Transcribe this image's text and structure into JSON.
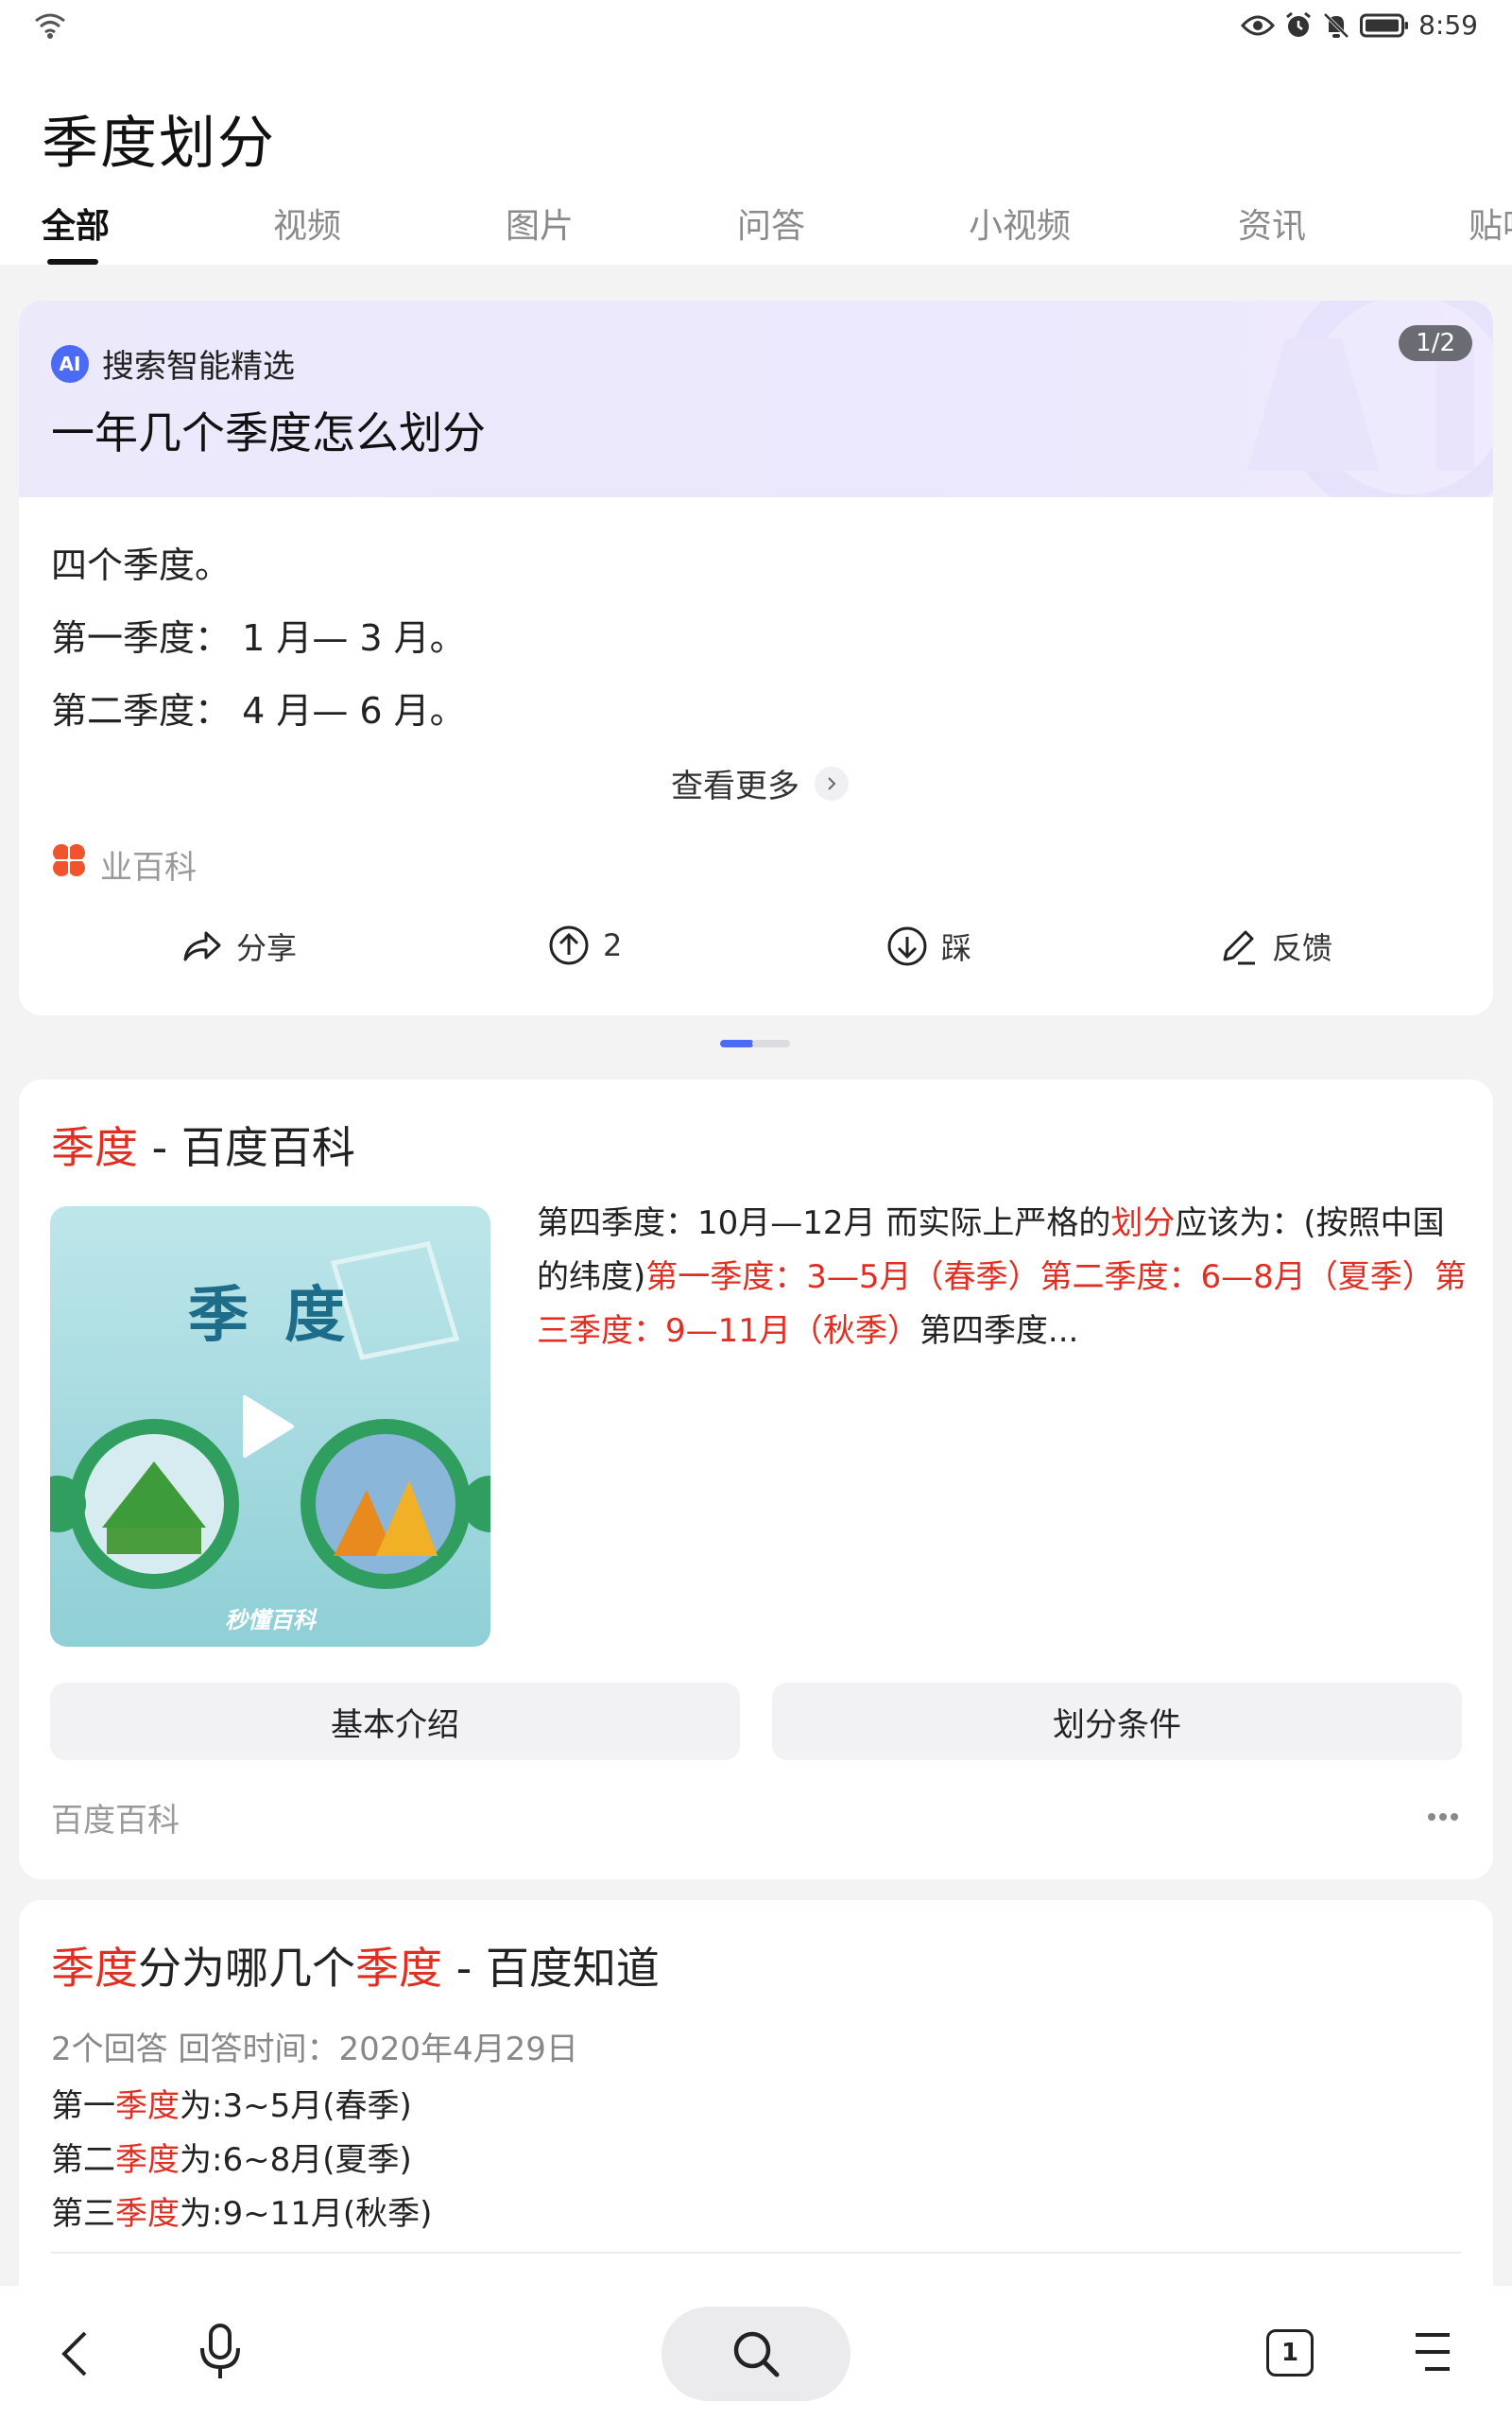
{
  "status_bar": {
    "time": "8:59",
    "icons": [
      "wifi-icon",
      "eye-icon",
      "alarm-icon",
      "bell-off-icon",
      "battery-icon"
    ]
  },
  "header": {
    "title": "季度划分",
    "tabs": [
      {
        "label": "全部",
        "active": true
      },
      {
        "label": "视频"
      },
      {
        "label": "图片"
      },
      {
        "label": "问答"
      },
      {
        "label": "小视频"
      },
      {
        "label": "资讯"
      },
      {
        "label": "贴吧"
      }
    ]
  },
  "ai_card": {
    "badge_logo": "AI",
    "badge": "搜索智能精选",
    "question": "一年几个季度怎么划分",
    "page_indicator": "1/2",
    "answer_lines": [
      "四个季度。",
      "第一季度： 1 月— 3 月。",
      "第二季度： 4 月— 6 月。"
    ],
    "view_more": "查看更多",
    "source": "业百科",
    "actions": {
      "share": "分享",
      "upvote_count": "2",
      "downvote": "踩",
      "feedback": "反馈"
    }
  },
  "baike_card": {
    "title_highlight": "季度",
    "title_rest": " - 百度百科",
    "thumb_title": "季 度",
    "thumb_brand": "秒懂百科",
    "desc_parts": [
      {
        "text": "第四季度：10月—12月 而实际上严格的",
        "hl": false
      },
      {
        "text": "划分",
        "hl": true
      },
      {
        "text": "应该为：(按照中国的纬度)",
        "hl": false
      },
      {
        "text": "第一季度：3—5月（春季）第二季度：6—8月（夏季）第三季度：9—11月（秋季）",
        "hl": true
      },
      {
        "text": "第四季度...",
        "hl": false
      }
    ],
    "chips": [
      "基本介绍",
      "划分条件"
    ],
    "source": "百度百科"
  },
  "zhidao_card": {
    "title_parts": [
      {
        "text": "季度",
        "hl": true
      },
      {
        "text": "分为哪几个",
        "hl": false
      },
      {
        "text": "季度",
        "hl": true
      },
      {
        "text": " - 百度知道",
        "hl": false
      }
    ],
    "meta": "2个回答   回答时间：2020年4月29日",
    "lines": [
      {
        "pre": "第一",
        "hl": "季度",
        "post": "为:3~5月(春季)"
      },
      {
        "pre": "第二",
        "hl": "季度",
        "post": "为:6~8月(夏季)"
      },
      {
        "pre": "第三",
        "hl": "季度",
        "post": "为:9~11月(秋季)"
      }
    ]
  },
  "bottom_nav": {
    "tab_count": "1"
  }
}
